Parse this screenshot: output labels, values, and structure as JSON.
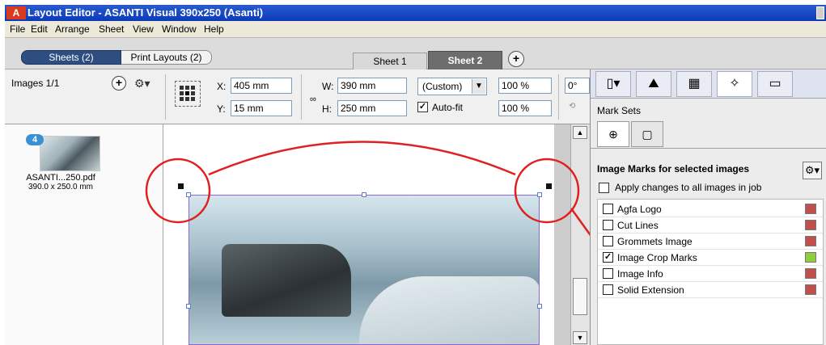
{
  "window": {
    "app_badge": "A",
    "title": "Layout Editor - ASANTI Visual 390x250 (Asanti)"
  },
  "menu": {
    "items": [
      "File",
      "Edit",
      "Arrange",
      "Sheet",
      "View",
      "Window",
      "Help"
    ]
  },
  "tabs_row": {
    "sheets_label": "Sheets (2)",
    "print_layouts_label": "Print Layouts (2)",
    "sheet_tabs": [
      "Sheet 1",
      "Sheet 2"
    ],
    "active_sheet": "Sheet 2",
    "add_sheet_symbol": "+"
  },
  "toolbar": {
    "images_label": "Images 1/1",
    "add_symbol": "+",
    "gear_symbol": "⚙▾",
    "x_label": "X:",
    "x_value": "405 mm",
    "y_label": "Y:",
    "y_value": "15 mm",
    "w_label": "W:",
    "w_value": "390 mm",
    "h_label": "H:",
    "h_value": "250 mm",
    "size_preset": "(Custom)",
    "autofit_label": "Auto-fit",
    "autofit_checked": true,
    "scale_x": "100 %",
    "scale_y": "100 %",
    "rotation": "0°"
  },
  "thumbnail": {
    "count_badge": "4",
    "name": "ASANTI...250.pdf",
    "size": "390.0 x 250.0 mm"
  },
  "right_panel": {
    "mark_sets_label": "Mark Sets",
    "section_title": "Image Marks for selected images",
    "apply_all_label": "Apply changes to all images in job",
    "apply_all_checked": false,
    "marks": [
      {
        "label": "Agfa Logo",
        "checked": false,
        "swatch": "#c0504d"
      },
      {
        "label": "Cut Lines",
        "checked": false,
        "swatch": "#c0504d"
      },
      {
        "label": "Grommets Image",
        "checked": false,
        "swatch": "#c0504d"
      },
      {
        "label": "Image Crop Marks",
        "checked": true,
        "swatch": "#8fce3f"
      },
      {
        "label": "Image Info",
        "checked": false,
        "swatch": "#c0504d"
      },
      {
        "label": "Solid Extension",
        "checked": false,
        "swatch": "#c0504d"
      }
    ]
  },
  "colors": {
    "annotation_red": "#e02020",
    "title_bar": "#0a3ab8",
    "selection_purple": "#8a6ad0",
    "enabled_swatch": "#8fce3f",
    "disabled_swatch": "#c0504d"
  }
}
